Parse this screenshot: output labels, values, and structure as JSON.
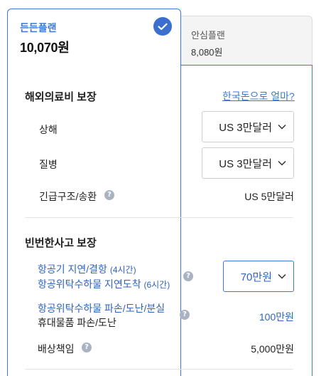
{
  "plans": [
    {
      "name": "든든플랜",
      "price": "10,070원",
      "selected": true
    },
    {
      "name": "안심플랜",
      "price": "8,080원",
      "selected": false
    }
  ],
  "medical": {
    "title": "해외의료비 보장",
    "link": "한국돈으로 얼마?",
    "rows": {
      "injury": {
        "label": "상해",
        "value": "US 3만달러"
      },
      "illness": {
        "label": "질병",
        "value": "US 3만달러"
      },
      "rescue": {
        "label": "긴급구조/송환",
        "value": "US 5만달러"
      }
    }
  },
  "frequent": {
    "title": "빈번한사고 보장",
    "rows": {
      "delay": {
        "line1": "항공기 지연/결항",
        "line1_note": "(4시간)",
        "line2": "항공위탁수하물 지연도착",
        "line2_note": "(6시간)",
        "value": "70만원"
      },
      "damage": {
        "line1": "항공위탁수하물 파손/도난/분실",
        "line2": "휴대물품 파손/도난",
        "value": "100만원"
      },
      "liability": {
        "label": "배상책임",
        "value": "5,000만원"
      }
    }
  },
  "colors": {
    "accent": "#3b78d8",
    "text": "#222222",
    "help_icon": "#a9b3c2"
  }
}
